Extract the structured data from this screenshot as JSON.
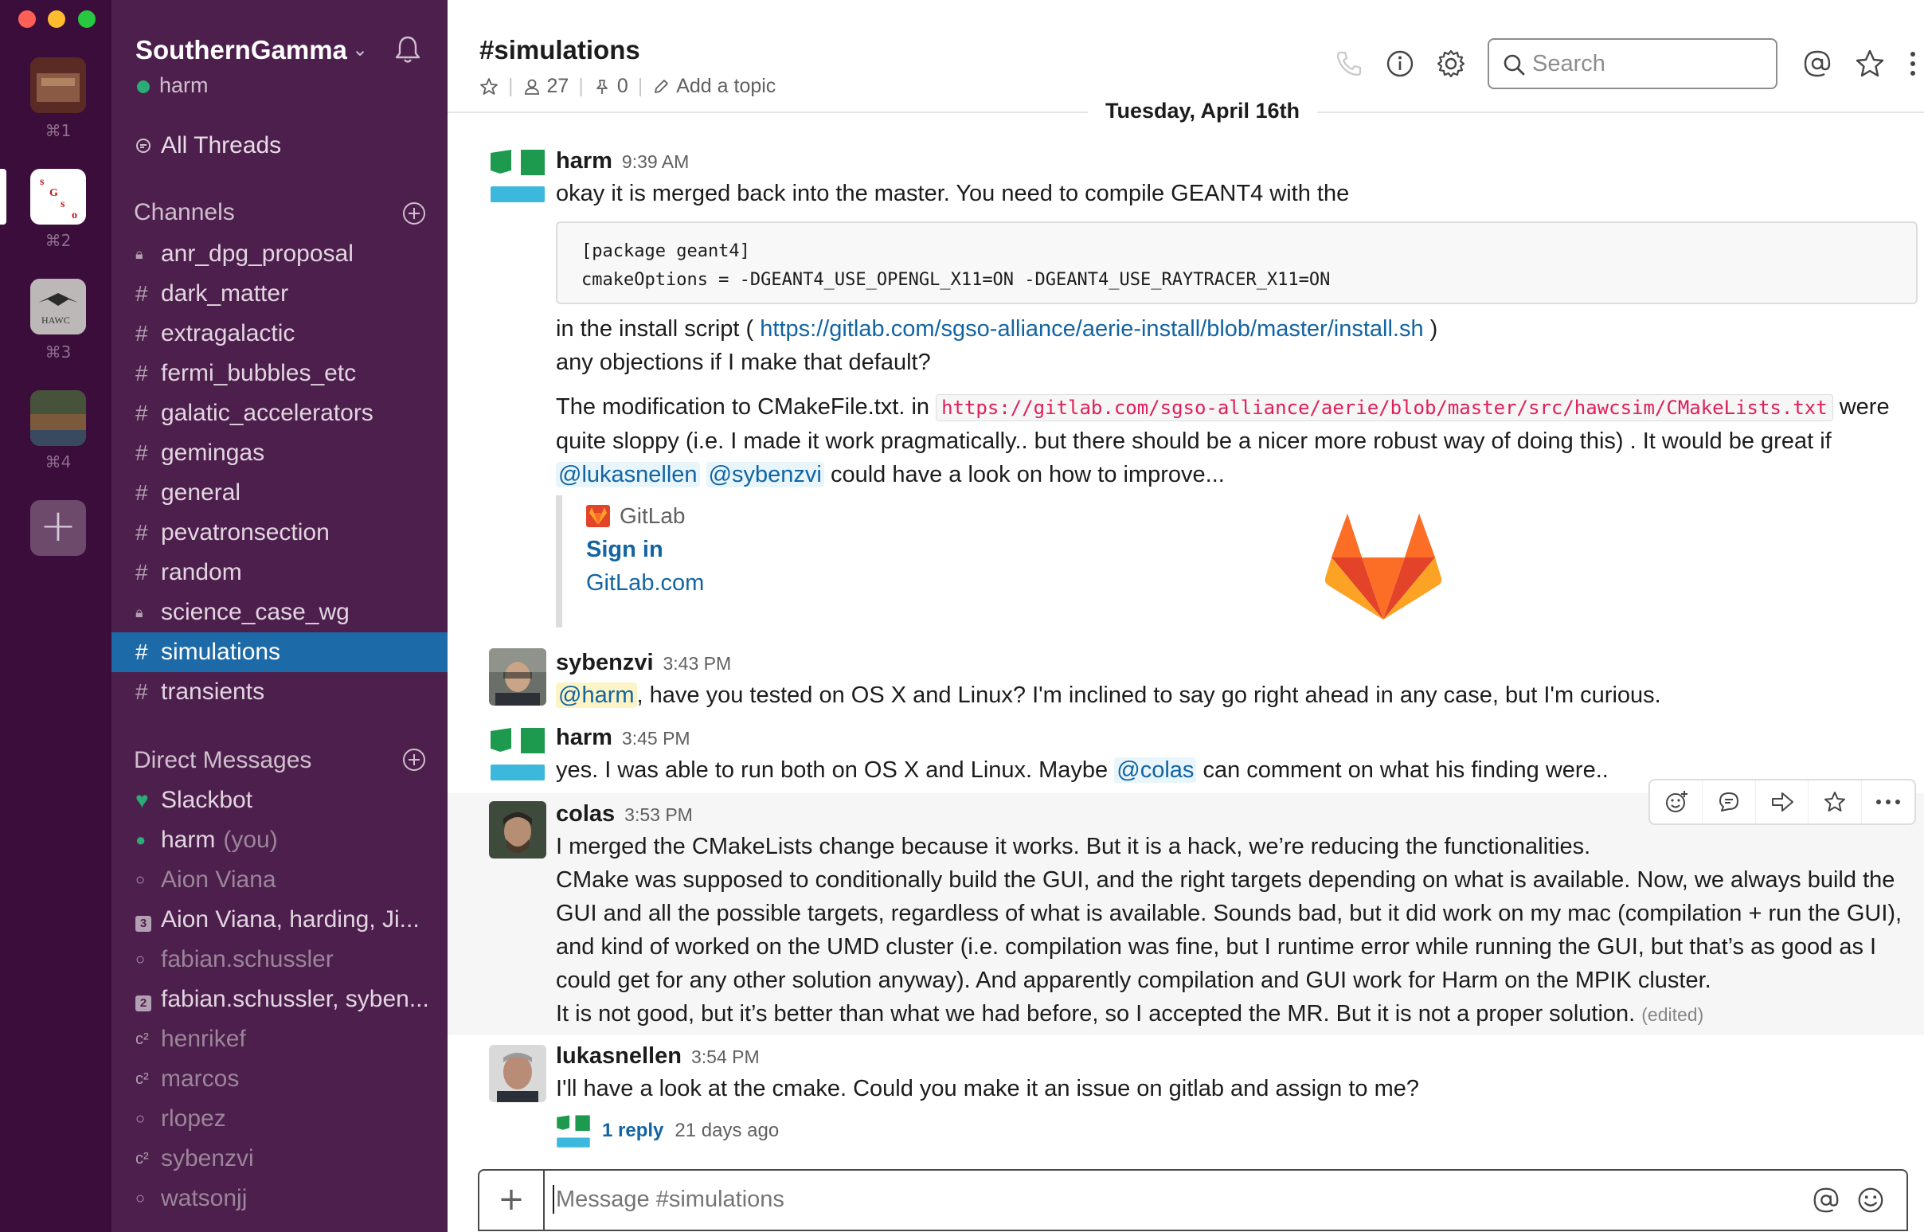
{
  "workspaces": [
    {
      "key": "⌘1"
    },
    {
      "key": "⌘2",
      "logo_text": "SGSO"
    },
    {
      "key": "⌘3",
      "logo_text": "HAWC"
    },
    {
      "key": "⌘4"
    }
  ],
  "sidebar": {
    "team_name": "SouthernGamma",
    "user": "harm",
    "all_threads": "All Threads",
    "channels_title": "Channels",
    "channels": [
      {
        "prefix": "🔒",
        "name": "anr_dpg_proposal"
      },
      {
        "prefix": "#",
        "name": "dark_matter"
      },
      {
        "prefix": "#",
        "name": "extragalactic"
      },
      {
        "prefix": "#",
        "name": "fermi_bubbles_etc"
      },
      {
        "prefix": "#",
        "name": "galatic_accelerators"
      },
      {
        "prefix": "#",
        "name": "gemingas"
      },
      {
        "prefix": "#",
        "name": "general"
      },
      {
        "prefix": "#",
        "name": "pevatronsection"
      },
      {
        "prefix": "#",
        "name": "random"
      },
      {
        "prefix": "🔒",
        "name": "science_case_wg"
      },
      {
        "prefix": "#",
        "name": "simulations"
      },
      {
        "prefix": "#",
        "name": "transients"
      }
    ],
    "dm_title": "Direct Messages",
    "dms": [
      {
        "prefix": "♥",
        "name": "Slackbot",
        "you": ""
      },
      {
        "prefix": "●",
        "name": "harm",
        "you": "(you)"
      },
      {
        "prefix": "○",
        "name": "Aion Viana",
        "you": ""
      },
      {
        "prefix": "3",
        "name": "Aion Viana, harding, Ji...",
        "you": ""
      },
      {
        "prefix": "○",
        "name": "fabian.schussler",
        "you": ""
      },
      {
        "prefix": "2",
        "name": "fabian.schussler, syben...",
        "you": ""
      },
      {
        "prefix": "c²",
        "name": "henrikef",
        "you": ""
      },
      {
        "prefix": "c²",
        "name": "marcos",
        "you": ""
      },
      {
        "prefix": "○",
        "name": "rlopez",
        "you": ""
      },
      {
        "prefix": "c²",
        "name": "sybenzvi",
        "you": ""
      },
      {
        "prefix": "○",
        "name": "watsonjj",
        "you": ""
      }
    ]
  },
  "header": {
    "channel": "#simulations",
    "members": "27",
    "pins": "0",
    "add_topic": "Add a topic",
    "search_placeholder": "Search"
  },
  "date_divider": "Tuesday, April 16th",
  "messages": {
    "m1": {
      "author": "harm",
      "time": "9:39 AM",
      "line1": "okay it is merged back into the master.  You need to compile GEANT4 with the",
      "code": "[package geant4]\ncmakeOptions = -DGEANT4_USE_OPENGL_X11=ON -DGEANT4_USE_RAYTRACER_X11=ON",
      "line2_pre": "in the install script  ( ",
      "line2_link": "https://gitlab.com/sgso-alliance/aerie-install/blob/master/install.sh",
      "line2_post": " )",
      "line3": "any objections if I make that default?",
      "p2_pre": "The modification to CMakeFile.txt. in ",
      "p2_code": "https://gitlab.com/sgso-alliance/aerie/blob/master/src/hawcsim/CMakeLists.txt",
      "p2_mid": " were quite sloppy (i.e. I  made it work pragmatically.. but there should be a nicer more robust way of doing this) . It would be great if ",
      "p2_mention1": "@lukasnellen",
      "p2_mention2": "@sybenzvi",
      "p2_post": " could have a look on how to improve...",
      "unfurl_site": "GitLab",
      "unfurl_title": "Sign in",
      "unfurl_desc": "GitLab.com"
    },
    "m2": {
      "author": "sybenzvi",
      "time": "3:43 PM",
      "mention": "@harm",
      "text": ", have you tested on OS X and Linux? I'm inclined to say go right ahead in any case, but I'm curious."
    },
    "m3": {
      "author": "harm",
      "time": "3:45 PM",
      "pre": "yes. I was able to run both on OS X and Linux. Maybe ",
      "mention": "@colas",
      "post": " can comment on what his finding were.."
    },
    "m4": {
      "author": "colas",
      "time": "3:53 PM",
      "line1": "I merged the CMakeLists change because it works. But it is a hack, we’re reducing the functionalities.",
      "line2": "CMake was supposed to conditionally build the GUI, and the right targets depending on what is available. Now, we always build the GUI and all the possible targets, regardless of what is available. Sounds bad, but it did work on my mac (compilation + run the GUI), and kind of worked on the UMD cluster (i.e. compilation was fine, but I runtime error while running the GUI, but that’s as good as I could get for any other solution anyway). And apparently compilation and GUI work for Harm on the MPIK cluster.",
      "line3": "It is not good, but it’s better than what we had before, so I accepted the MR. But it is not a proper solution.",
      "edited": "(edited)"
    },
    "m5": {
      "author": "lukasnellen",
      "time": "3:54 PM",
      "text": "I'll have a look at the cmake. Could you make it an issue on gitlab and assign to me?",
      "reply_count": "1 reply",
      "reply_age": "21 days ago"
    }
  },
  "composer": {
    "placeholder": "Message #simulations"
  },
  "colors": {
    "sidebar_bg": "#4d1f4c",
    "rail_bg": "#3b0d3a",
    "active_channel": "#1d6aa8",
    "link": "#1264a3",
    "presence_green": "#2bac76"
  }
}
